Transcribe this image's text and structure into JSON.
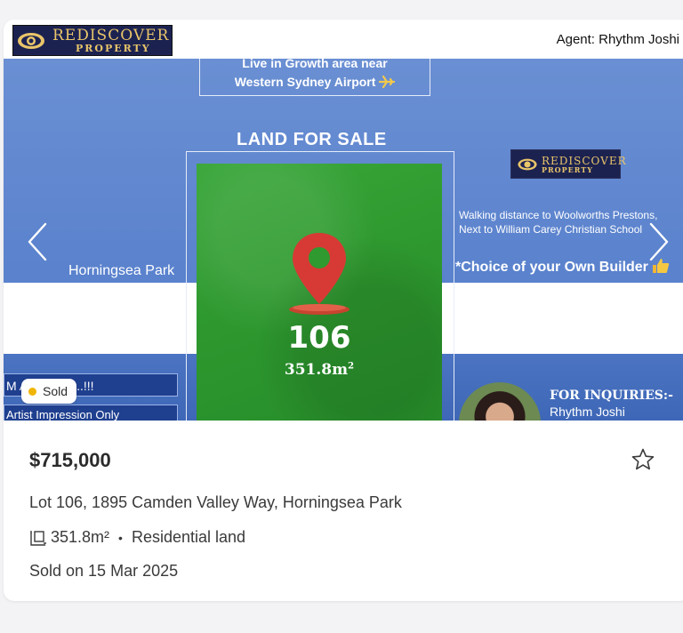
{
  "header": {
    "brand_word1": "REDISCOVER",
    "brand_word2": "PROPERTY",
    "agent_text": "Agent: Rhythm Joshi"
  },
  "hero_image": {
    "growth_line1": "Live in Growth area near",
    "growth_line2": "Western Sydney Airport",
    "land_title": "LAND FOR SALE",
    "lot_number": "106",
    "lot_area": "351.8m",
    "lot_area_sup": "2",
    "suburb": "Horningsea Park",
    "small_logo_word1": "REDISCOVER",
    "small_logo_word2": "PROPERTY",
    "walking_line1": "Walking distance to Woolworths Prestons,",
    "walking_line2": "Next to William Carey Christian School",
    "builder": "*Choice of your Own Builder",
    "moment_text": "M      Available....!!!",
    "artist_text": "Artist Impression Only",
    "inquiries_label": "FOR INQUIRIES:-",
    "inquiries_name": "Rhythm Joshi"
  },
  "status": {
    "label": "Sold",
    "dot_color": "#f0b500"
  },
  "listing": {
    "price": "$715,000",
    "address": "Lot 106, 1895 Camden Valley Way, Horningsea Park",
    "land_size": "351.8m²",
    "separator": "•",
    "property_type": "Residential land",
    "sold_date": "Sold on 15 Mar 2025"
  },
  "icons": {
    "prev": "chevron-left-icon",
    "next": "chevron-right-icon",
    "favourite": "star-outline-icon",
    "land_size": "land-size-icon"
  },
  "colors": {
    "hero_blue": "#5a82cd",
    "grass_green": "#2f9a2f",
    "pin_red": "#d73a35",
    "brand_gold": "#e9c56a",
    "brand_navy": "#1c2250"
  }
}
